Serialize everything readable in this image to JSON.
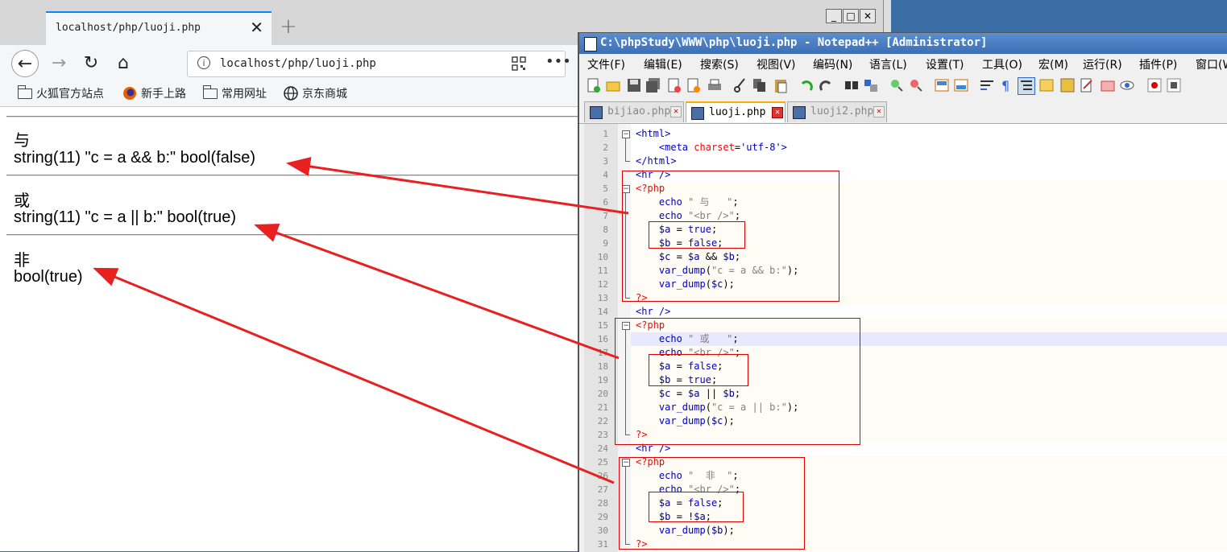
{
  "browser": {
    "tab_title": "localhost/php/luoji.php",
    "url": "localhost/php/luoji.php",
    "bookmarks": [
      "火狐官方站点",
      "新手上路",
      "常用网址",
      "京东商城"
    ],
    "output": {
      "label_and": "与",
      "line_and": "string(11) \"c = a && b:\" bool(false)",
      "label_or": "或",
      "line_or": "string(11) \"c = a || b:\" bool(true)",
      "label_not": "非",
      "line_not": "bool(true)"
    }
  },
  "notepad": {
    "title": "C:\\phpStudy\\WWW\\php\\luoji.php - Notepad++ [Administrator]",
    "menu": [
      "文件(F)",
      "编辑(E)",
      "搜索(S)",
      "视图(V)",
      "编码(N)",
      "语言(L)",
      "设置(T)",
      "工具(O)",
      "宏(M)",
      "运行(R)",
      "插件(P)",
      "窗口(W"
    ],
    "tabs": [
      {
        "label": "bijiao.php",
        "active": false
      },
      {
        "label": "luoji.php",
        "active": true
      },
      {
        "label": "luoji2.php",
        "active": false
      }
    ],
    "line_numbers": [
      "1",
      "2",
      "3",
      "4",
      "5",
      "6",
      "7",
      "8",
      "9",
      "10",
      "11",
      "12",
      "13",
      "14",
      "15",
      "16",
      "17",
      "18",
      "19",
      "20",
      "21",
      "22",
      "23",
      "24",
      "25",
      "26",
      "27",
      "28",
      "29",
      "30",
      "31"
    ],
    "code": [
      "<html>",
      "    <meta charset='utf-8'>",
      "</html>",
      "<hr />",
      "<?php",
      "    echo \" 与   \";",
      "    echo \"<br />\";",
      "    $a = true;",
      "    $b = false;",
      "    $c = $a && $b;",
      "    var_dump(\"c = a && b:\");",
      "    var_dump($c);",
      "?>",
      "<hr />",
      "<?php",
      "    echo \" 或   \";",
      "    echo \"<br />\";",
      "    $a = false;",
      "    $b = true;",
      "    $c = $a || $b;",
      "    var_dump(\"c = a || b:\");",
      "    var_dump($c);",
      "?>",
      "<hr />",
      "<?php",
      "    echo \"  非  \";",
      "    echo \"<br />\";",
      "    $a = false;",
      "    $b = !$a;",
      "    var_dump($b);",
      "?>"
    ]
  },
  "colors": {
    "annotation": "#e82020",
    "tab_accent": "#0a84ff",
    "npp_title": "#3c6eb4"
  }
}
